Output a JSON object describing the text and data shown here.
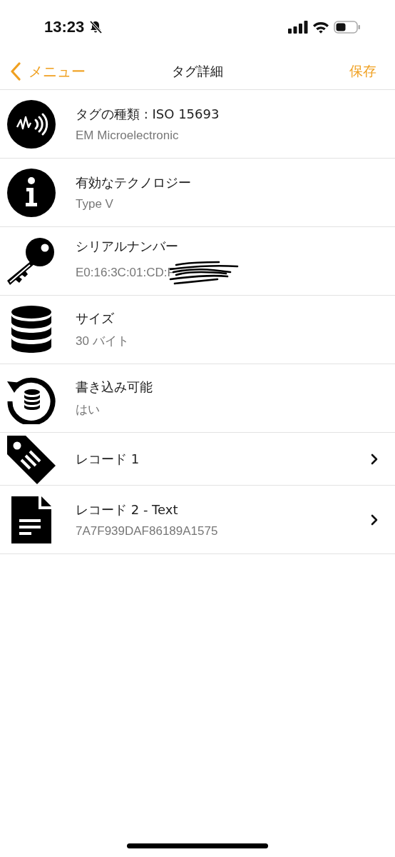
{
  "status_bar": {
    "time": "13:23",
    "silent": true
  },
  "nav": {
    "back": "メニュー",
    "title": "タグ詳細",
    "action": "保存"
  },
  "rows": [
    {
      "kind": "nfc",
      "title": "タグの種類 : ISO 15693",
      "subtitle": "EM Microelectronic",
      "disclosure": false
    },
    {
      "kind": "info",
      "title": "有効なテクノロジー",
      "subtitle": "Type V",
      "disclosure": false
    },
    {
      "kind": "key",
      "title": "シリアルナンバー",
      "subtitle": "E0:16:3C:01:CD:F",
      "scribbled": true,
      "disclosure": false
    },
    {
      "kind": "database",
      "title": "サイズ",
      "subtitle": "30 バイト",
      "disclosure": false
    },
    {
      "kind": "rewrite",
      "title": "書き込み可能",
      "subtitle": "はい",
      "disclosure": false
    },
    {
      "kind": "tag",
      "title": "レコード 1",
      "disclosure": true
    },
    {
      "kind": "document",
      "title": "レコード 2 - Text",
      "subtitle": "7A7F939DAF86189A1575",
      "disclosure": true
    }
  ]
}
